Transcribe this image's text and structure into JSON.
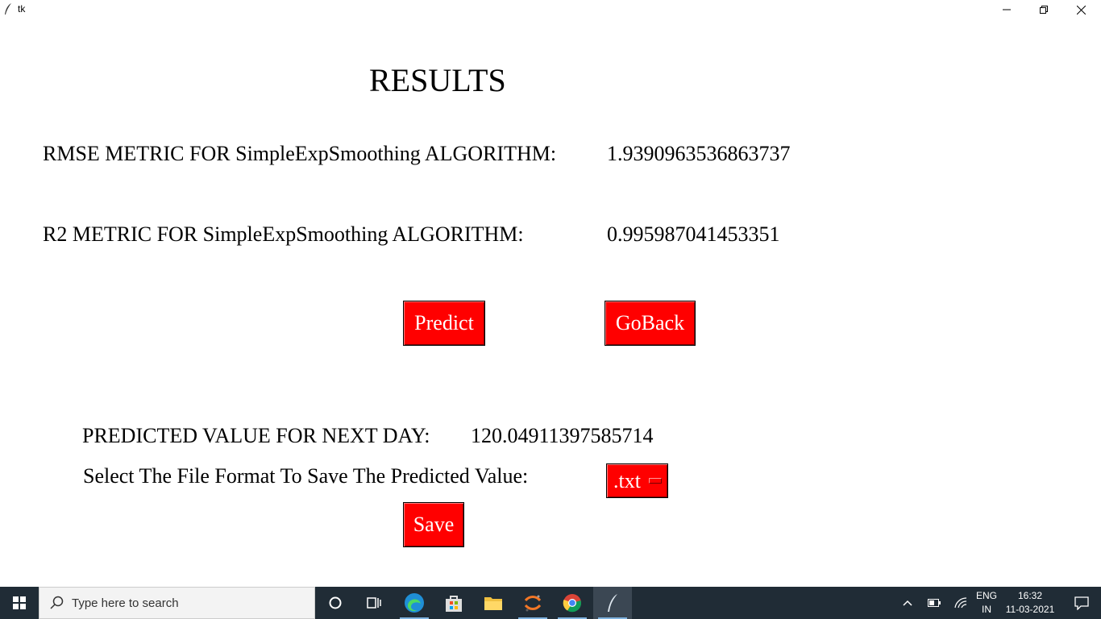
{
  "window": {
    "title": "tk"
  },
  "content": {
    "heading": "RESULTS",
    "rmse_label": "RMSE METRIC FOR SimpleExpSmoothing ALGORITHM:",
    "rmse_value": "1.9390963536863737",
    "r2_label": "R2 METRIC FOR SimpleExpSmoothing ALGORITHM:",
    "r2_value": "0.995987041453351",
    "predict_label": "Predict",
    "goback_label": "GoBack",
    "predicted_label": "PREDICTED VALUE FOR NEXT DAY:",
    "predicted_value": "120.04911397585714",
    "format_label": "Select The File Format To Save The Predicted Value:",
    "format_selected": ".txt",
    "save_label": "Save",
    "button_color": "#ff0000"
  },
  "taskbar": {
    "search_placeholder": "Type here to search",
    "language": "ENG",
    "region": "IN",
    "time": "16:32",
    "date": "11-03-2021",
    "background": "#202c36"
  }
}
